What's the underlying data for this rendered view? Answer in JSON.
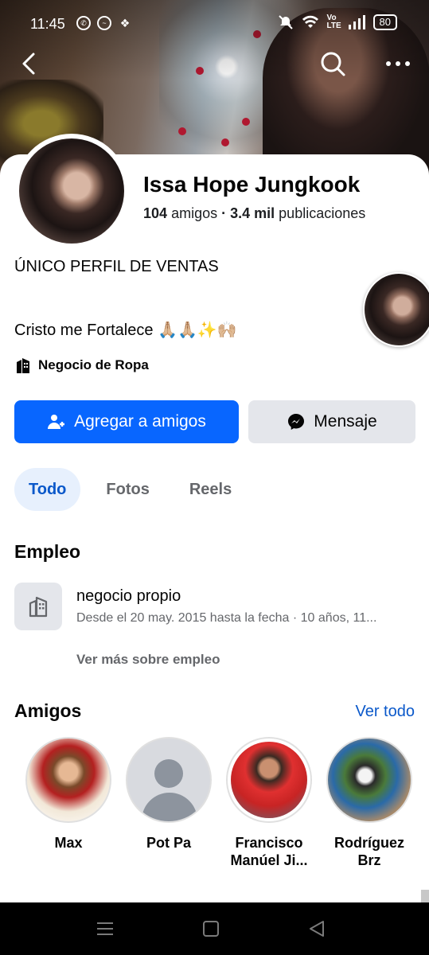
{
  "status_bar": {
    "time": "11:45",
    "battery": "80",
    "network": "Vo LTE"
  },
  "profile": {
    "name": "Issa Hope Jungkook",
    "friends_count": "104",
    "friends_label": "amigos",
    "separator": "·",
    "posts_count": "3.4 mil",
    "posts_label": "publicaciones",
    "bio_line1": "ÚNICO PERFIL DE  VENTAS",
    "bio_line2": "Cristo me Fortalece 🙏🏼🙏🏼✨🙌🏼",
    "category": "Negocio de Ropa"
  },
  "actions": {
    "add_friend": "Agregar a amigos",
    "message": "Mensaje"
  },
  "tabs": [
    {
      "label": "Todo",
      "active": true
    },
    {
      "label": "Fotos",
      "active": false
    },
    {
      "label": "Reels",
      "active": false
    }
  ],
  "employment": {
    "title": "Empleo",
    "job": "negocio propio",
    "dates": "Desde el 20 may. 2015 hasta la fecha · 10 años, 11...",
    "more": "Ver más sobre empleo"
  },
  "friends_section": {
    "title": "Amigos",
    "see_all": "Ver todo",
    "items": [
      {
        "name_line1": "Max",
        "name_line2": ""
      },
      {
        "name_line1": "Pot Pa",
        "name_line2": ""
      },
      {
        "name_line1": "Francisco",
        "name_line2": "Manúel Ji..."
      },
      {
        "name_line1": "Rodríguez",
        "name_line2": "Brz"
      }
    ]
  },
  "colors": {
    "primary": "#0866ff",
    "link": "#0a58ca",
    "secondary_button": "#e4e6eb",
    "muted_text": "#65676b",
    "active_tab_bg": "#e7f0fd"
  },
  "icons": [
    "back-icon",
    "search-icon",
    "more-icon",
    "add-person-icon",
    "messenger-icon",
    "building-icon",
    "menu-nav-icon",
    "home-nav-icon",
    "back-nav-icon"
  ]
}
